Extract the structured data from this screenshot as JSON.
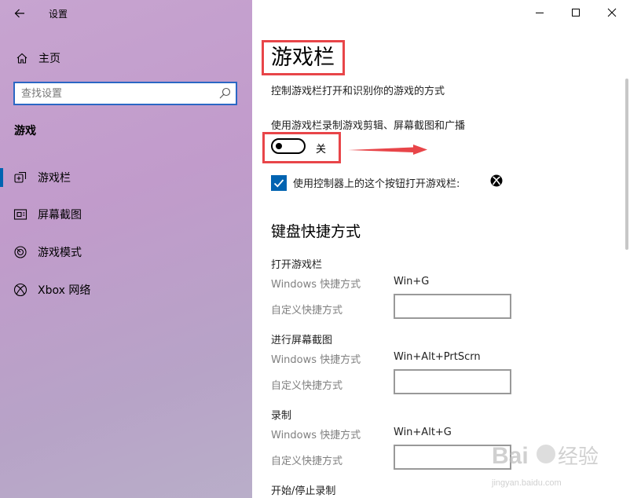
{
  "window": {
    "title": "设置",
    "back_icon": "back-arrow-icon",
    "controls": [
      "minimize-icon",
      "maximize-icon",
      "close-icon"
    ]
  },
  "sidebar": {
    "home_label": "主页",
    "search_placeholder": "查找设置",
    "section_title": "游戏",
    "items": [
      {
        "label": "游戏栏",
        "icon": "game-bar-icon",
        "selected": true
      },
      {
        "label": "屏幕截图",
        "icon": "captures-icon",
        "selected": false
      },
      {
        "label": "游戏模式",
        "icon": "game-mode-icon",
        "selected": false
      },
      {
        "label": "Xbox 网络",
        "icon": "xbox-icon",
        "selected": false
      }
    ]
  },
  "main": {
    "title": "游戏栏",
    "description": "控制游戏栏打开和识别你的游戏的方式",
    "record_toggle": {
      "caption": "使用游戏栏录制游戏剪辑、屏幕截图和广播",
      "state_label": "关",
      "on": false
    },
    "controller_checkbox": {
      "label": "使用控制器上的这个按钮打开游戏栏:",
      "checked": true,
      "icon": "xbox-logo-icon"
    },
    "shortcuts_heading": "键盘快捷方式",
    "shortcuts": [
      {
        "title": "打开游戏栏",
        "windows_label": "Windows 快捷方式",
        "windows_value": "Win+G",
        "custom_label": "自定义快捷方式",
        "custom_value": ""
      },
      {
        "title": "进行屏幕截图",
        "windows_label": "Windows 快捷方式",
        "windows_value": "Win+Alt+PrtScrn",
        "custom_label": "自定义快捷方式",
        "custom_value": ""
      },
      {
        "title": "录制",
        "windows_label": "Windows 快捷方式",
        "windows_value": "Win+Alt+G",
        "custom_label": "自定义快捷方式",
        "custom_value": ""
      },
      {
        "title": "开始/停止录制"
      }
    ]
  },
  "colors": {
    "accent": "#0063b1",
    "annotation_red": "#e84549",
    "search_border": "#2b67c4"
  },
  "watermark": {
    "brand": "Baidu 经验",
    "url": "jingyan.baidu.com"
  }
}
